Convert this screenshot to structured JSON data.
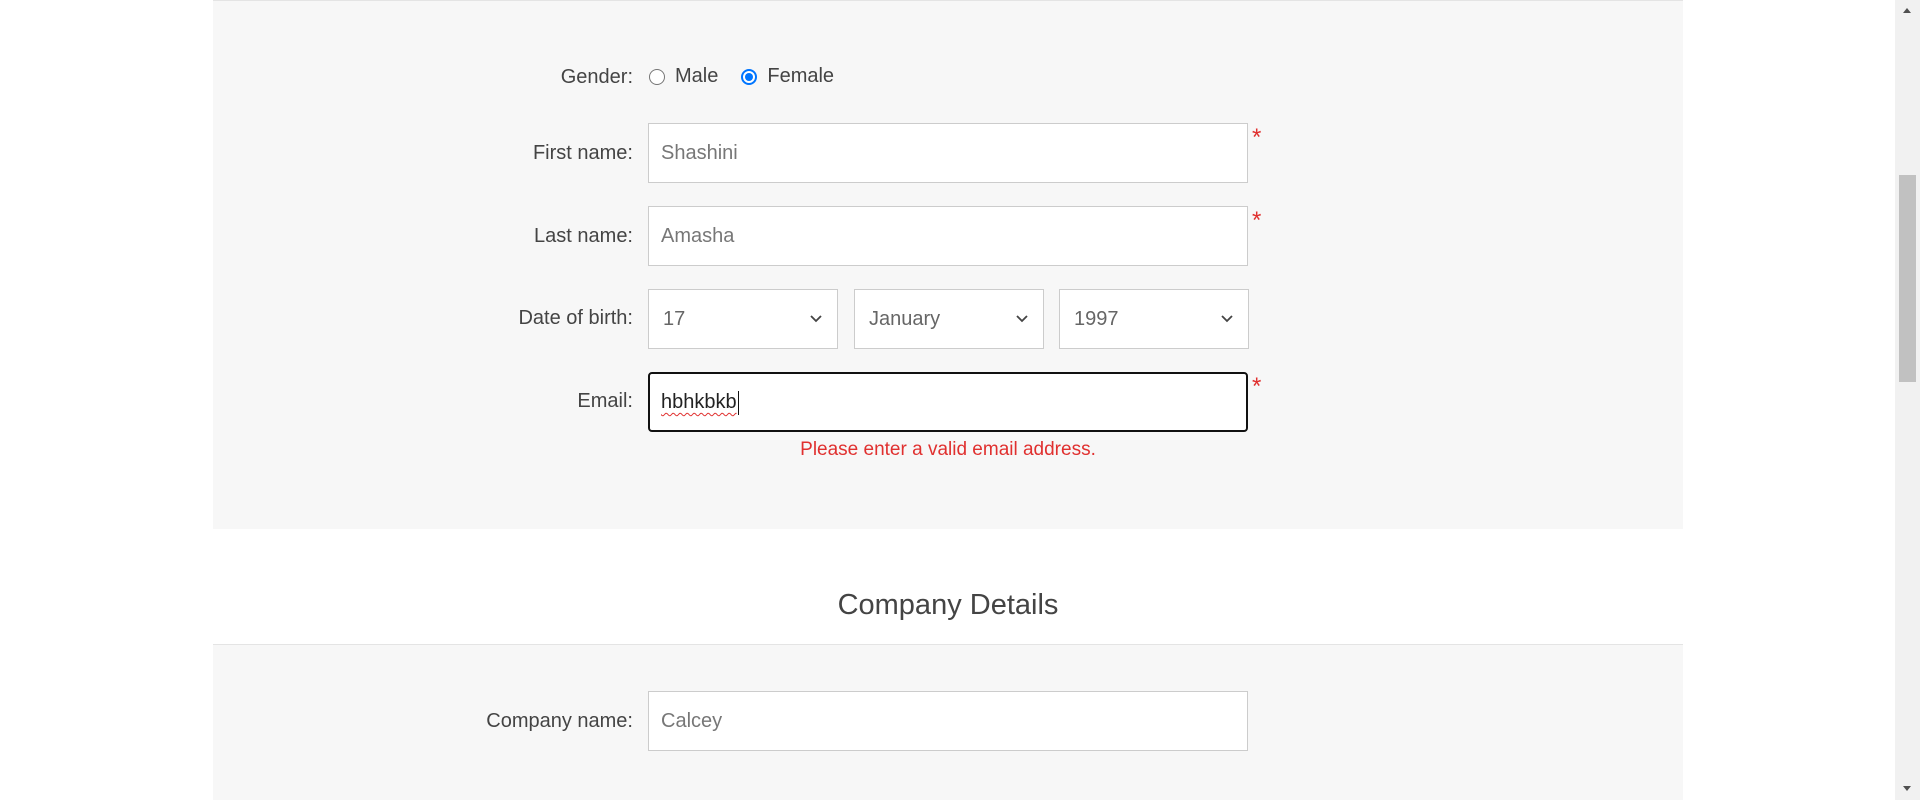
{
  "personal": {
    "gender_label": "Gender:",
    "gender_options": [
      {
        "label": "Male",
        "checked": false
      },
      {
        "label": "Female",
        "checked": true
      }
    ],
    "first_name_label": "First name:",
    "first_name_value": "Shashini",
    "last_name_label": "Last name:",
    "last_name_value": "Amasha",
    "dob_label": "Date of birth:",
    "dob_day": "17",
    "dob_month": "January",
    "dob_year": "1997",
    "email_label": "Email:",
    "email_value": "hbhkbkb",
    "email_error": "Please enter a valid email address.",
    "required_mark": "*"
  },
  "company": {
    "heading": "Company Details",
    "company_name_label": "Company name:",
    "company_name_value": "Calcey"
  },
  "colors": {
    "error": "#e0302f",
    "radio_accent": "#0075ff",
    "section_bg": "#f7f7f7"
  },
  "icons": {
    "select_arrow": "chevron-down-icon",
    "scroll_up": "scroll-up-arrow-icon",
    "scroll_down": "scroll-down-arrow-icon"
  }
}
